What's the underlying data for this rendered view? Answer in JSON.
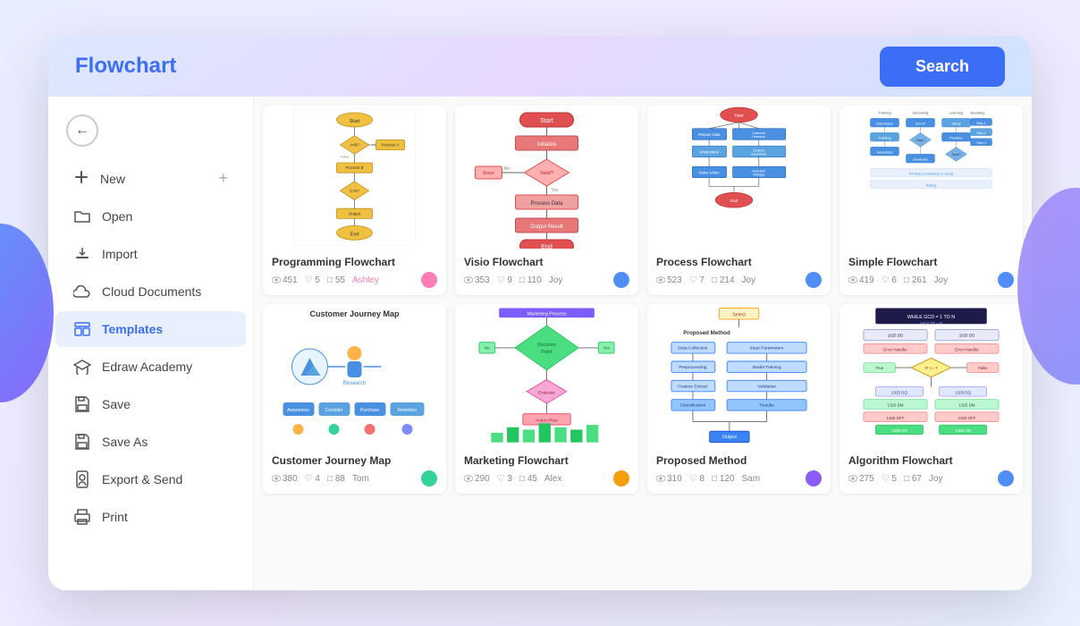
{
  "header": {
    "title": "Flowchart",
    "search_label": "Search",
    "bg_gradient": "linear-gradient(135deg, #dce8ff, #e8d8ff, #d0e4ff)"
  },
  "sidebar": {
    "back_label": "←",
    "items": [
      {
        "id": "new",
        "label": "New",
        "icon": "＋",
        "extra": "+",
        "active": false
      },
      {
        "id": "open",
        "label": "Open",
        "icon": "📁",
        "active": false
      },
      {
        "id": "import",
        "label": "Import",
        "icon": "📥",
        "active": false
      },
      {
        "id": "cloud",
        "label": "Cloud Documents",
        "icon": "☁",
        "active": false
      },
      {
        "id": "templates",
        "label": "Templates",
        "icon": "🖥",
        "active": true
      },
      {
        "id": "academy",
        "label": "Edraw Academy",
        "icon": "🎓",
        "active": false
      },
      {
        "id": "save",
        "label": "Save",
        "icon": "💾",
        "active": false
      },
      {
        "id": "saveas",
        "label": "Save As",
        "icon": "💾",
        "active": false
      },
      {
        "id": "export",
        "label": "Export & Send",
        "icon": "🔒",
        "active": false
      },
      {
        "id": "print",
        "label": "Print",
        "icon": "🖨",
        "active": false
      }
    ]
  },
  "templates": [
    {
      "id": "programming-flowchart",
      "name": "Programming Flowchart",
      "views": 451,
      "likes": 5,
      "comments": 55,
      "author": "Ashley",
      "avatar_color": "#ff7eb3",
      "theme": "yellow"
    },
    {
      "id": "visio-flowchart",
      "name": "Visio Flowchart",
      "views": 353,
      "likes": 9,
      "comments": 110,
      "author": "Joy",
      "avatar_color": "#4f8ef7",
      "theme": "pink"
    },
    {
      "id": "process-flowchart",
      "name": "Process Flowchart",
      "views": 523,
      "likes": 7,
      "comments": 214,
      "author": "Joy",
      "avatar_color": "#4f8ef7",
      "theme": "blue"
    },
    {
      "id": "simple-flowchart",
      "name": "Simple Flowchart",
      "views": 419,
      "likes": 6,
      "comments": 261,
      "author": "Joy",
      "avatar_color": "#4f8ef7",
      "theme": "simple"
    },
    {
      "id": "customer-journey-map",
      "name": "Customer Journey Map",
      "views": 380,
      "likes": 4,
      "comments": 88,
      "author": "Tom",
      "avatar_color": "#34d399",
      "theme": "journey"
    },
    {
      "id": "marketing-flowchart",
      "name": "Marketing Flowchart",
      "views": 290,
      "likes": 3,
      "comments": 45,
      "author": "Alex",
      "avatar_color": "#f59e0b",
      "theme": "green"
    },
    {
      "id": "proposed-method",
      "name": "Proposed Method",
      "views": 310,
      "likes": 8,
      "comments": 120,
      "author": "Sam",
      "avatar_color": "#8b5cf6",
      "theme": "proposed"
    },
    {
      "id": "algorithm-flowchart",
      "name": "Algorithm Flowchart",
      "views": 275,
      "likes": 5,
      "comments": 67,
      "author": "Joy",
      "avatar_color": "#4f8ef7",
      "theme": "algorithm"
    }
  ],
  "icons": {
    "eye": "👁",
    "heart": "♡",
    "comment": "💬",
    "back": "←",
    "plus": "+",
    "new": "✚",
    "open": "📂",
    "import": "📥",
    "cloud": "☁",
    "monitor": "🖥",
    "academy": "🎓",
    "save": "💾",
    "lock": "🔒",
    "print": "🖨"
  }
}
